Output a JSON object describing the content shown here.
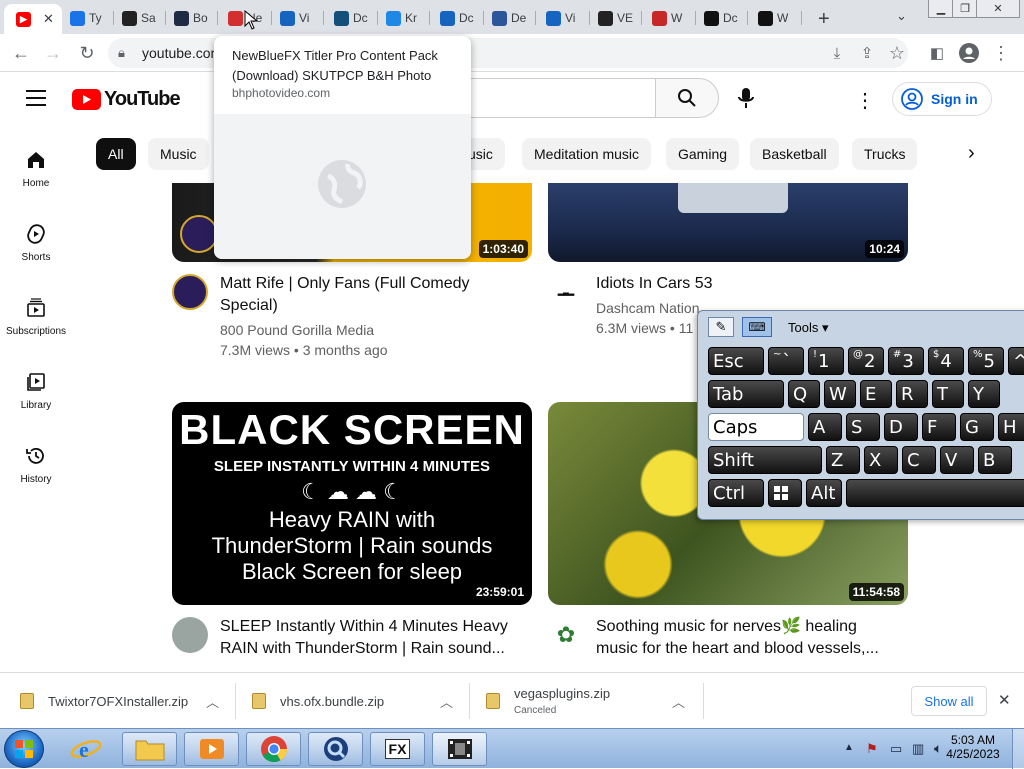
{
  "tabs": [
    {
      "label": "",
      "favicon": "youtube-icon",
      "color": "#ff0000"
    },
    {
      "label": "Ty",
      "favicon": "doc-icon",
      "color": "#1a73e8"
    },
    {
      "label": "Sa",
      "favicon": "rwe-icon",
      "color": "#222222"
    },
    {
      "label": "Bo",
      "favicon": "v-icon",
      "color": "#1f2a44"
    },
    {
      "label": "Ne",
      "favicon": "bh-icon",
      "color": "#d32f2f"
    },
    {
      "label": "Vi",
      "favicon": "play-icon",
      "color": "#1565c0"
    },
    {
      "label": "Dc",
      "favicon": "q-icon",
      "color": "#14507a"
    },
    {
      "label": "Kr",
      "favicon": "music-icon",
      "color": "#1e88e5"
    },
    {
      "label": "Dc",
      "favicon": "shield-icon",
      "color": "#1565c0"
    },
    {
      "label": "De",
      "favicon": "doc2-icon",
      "color": "#2b579a"
    },
    {
      "label": "Vi",
      "favicon": "play-icon",
      "color": "#1565c0"
    },
    {
      "label": "VE",
      "favicon": "columns-icon",
      "color": "#222222"
    },
    {
      "label": "W",
      "favicon": "star-icon",
      "color": "#c62828"
    },
    {
      "label": "Dc",
      "favicon": "w-icon",
      "color": "#111111"
    },
    {
      "label": "W",
      "favicon": "w-icon",
      "color": "#111111"
    }
  ],
  "address_bar": {
    "url": "youtube.com"
  },
  "tab_popup": {
    "title": "NewBlueFX Titler Pro Content Pack (Download) SKUTPCP B&H Photo",
    "domain": "bhphotovideo.com"
  },
  "youtube": {
    "logo_text": "YouTube",
    "sign_in": "Sign in",
    "chips": [
      "All",
      "Music",
      "usic",
      "Meditation music",
      "Gaming",
      "Basketball",
      "Trucks"
    ],
    "sidebar": [
      {
        "label": "Home",
        "icon": "home-icon"
      },
      {
        "label": "Shorts",
        "icon": "shorts-icon"
      },
      {
        "label": "Subscriptions",
        "icon": "subscriptions-icon"
      },
      {
        "label": "Library",
        "icon": "library-icon"
      },
      {
        "label": "History",
        "icon": "history-icon"
      }
    ],
    "videos": [
      {
        "title_line1": "Matt Rife | Only Fans (Full Comedy",
        "title_line2": "Special)",
        "channel": "800 Pound Gorilla Media",
        "meta": "7.3M views • 3 months ago",
        "duration": "1:03:40"
      },
      {
        "title_line1": "Idiots In Cars 53",
        "title_line2": "",
        "channel": "Dashcam Nation",
        "meta": "6.3M views • 11",
        "duration": "10:24"
      },
      {
        "title_line1": "SLEEP Instantly Within 4 Minutes Heavy",
        "title_line2": "RAIN with ThunderStorm | Rain sound...",
        "channel": "",
        "meta": "",
        "duration": "23:59:01",
        "thumb_text": [
          "BLACK SCREEN",
          "SLEEP INSTANTLY WITHIN 4 MINUTES",
          "Heavy RAIN with",
          "ThunderStorm | Rain sounds",
          "Black Screen for sleep"
        ]
      },
      {
        "title_line1": "Soothing music for nerves🌿 healing",
        "title_line2": "music for the heart and blood vessels,...",
        "channel": "",
        "meta": "",
        "duration": "11:54:58"
      }
    ]
  },
  "osk": {
    "tools_label": "Tools",
    "row1": [
      {
        "main": "Esc"
      },
      {
        "main": "` ",
        "top": "~"
      },
      {
        "main": "1",
        "top": "!"
      },
      {
        "main": "2",
        "top": "@"
      },
      {
        "main": "3",
        "top": "#"
      },
      {
        "main": "4",
        "top": "$"
      },
      {
        "main": "5",
        "top": "%"
      },
      {
        "main": "^"
      }
    ],
    "row2": [
      "Tab",
      "Q",
      "W",
      "E",
      "R",
      "T",
      "Y"
    ],
    "row3": [
      "Caps",
      "A",
      "S",
      "D",
      "F",
      "G",
      "H"
    ],
    "row4": [
      "Shift",
      "Z",
      "X",
      "C",
      "V",
      "B"
    ],
    "row5": [
      "Ctrl",
      "",
      "Alt",
      ""
    ]
  },
  "downloads": [
    {
      "name": "Twixtor7OFXInstaller.zip",
      "status": ""
    },
    {
      "name": "vhs.ofx.bundle.zip",
      "status": ""
    },
    {
      "name": "vegasplugins.zip",
      "status": "Canceled"
    }
  ],
  "downloads_show_all": "Show all",
  "taskbar": {
    "time": "5:03 AM",
    "date": "4/25/2023"
  }
}
